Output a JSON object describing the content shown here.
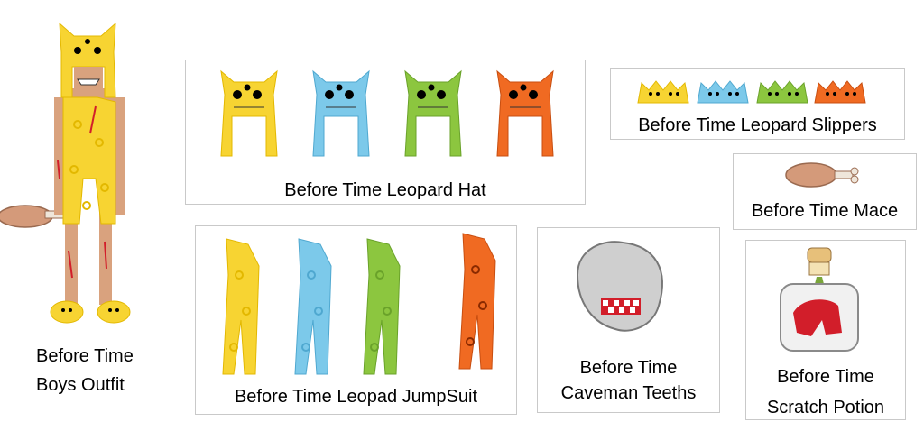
{
  "colors": {
    "yellow": "#F7D432",
    "blue": "#7CC9EA",
    "green": "#8CC63F",
    "orange": "#F06A22",
    "skin": "#D9A27E",
    "meat": "#D49A7A",
    "bone": "#EFE6DA",
    "grey": "#CFCFCF",
    "red": "#D21E2A",
    "border": "#C9C9C9"
  },
  "variants": [
    "yellow",
    "blue",
    "green",
    "orange"
  ],
  "outfit": {
    "label_line1": "Before Time",
    "label_line2": "Boys Outfit"
  },
  "items": {
    "hat": {
      "label": "Before Time Leopard Hat"
    },
    "slippers": {
      "label": "Before Time Leopard Slippers"
    },
    "mace": {
      "label": "Before Time Mace"
    },
    "jumpsuit": {
      "label": "Before Time Leopad JumpSuit"
    },
    "teeth": {
      "label_line1": "Before Time",
      "label_line2": "Caveman Teeths"
    },
    "potion": {
      "label_line1": "Before Time",
      "label_line2": "Scratch Potion"
    }
  }
}
